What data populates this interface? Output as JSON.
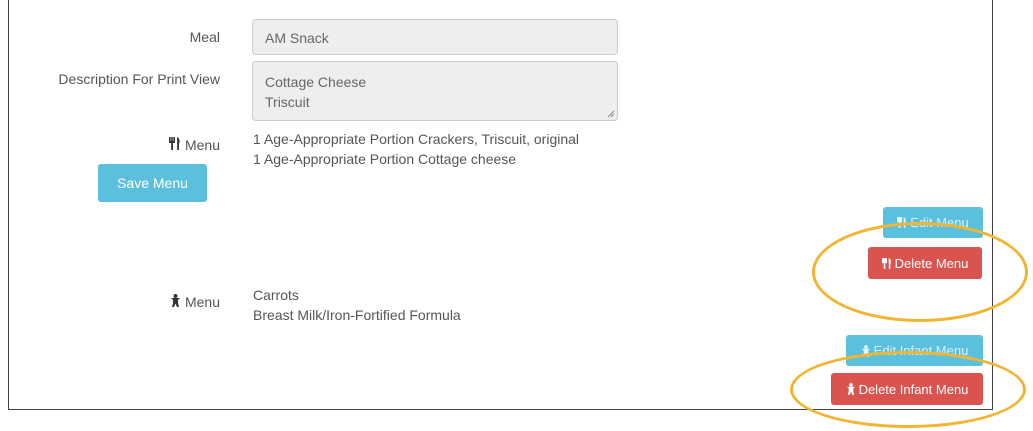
{
  "form": {
    "meal_label": "Meal",
    "meal_value": "AM Snack",
    "description_label": "Description For Print View",
    "description_lines": [
      "Cottage Cheese",
      "Triscuit"
    ],
    "menu_label": "Menu",
    "menu_items": [
      "1 Age-Appropriate Portion Crackers, Triscuit, original",
      "1 Age-Appropriate Portion Cottage cheese"
    ],
    "save_menu_label": "Save Menu",
    "edit_menu_label": "Edit Menu",
    "delete_menu_label": "Delete Menu",
    "infant_menu_label": "Menu",
    "infant_menu_items": [
      "Carrots",
      "Breast Milk/Iron-Fortified Formula"
    ],
    "edit_infant_menu_label": "Edit Infant Menu",
    "delete_infant_menu_label": "Delete Infant Menu"
  },
  "icons": {
    "menu_icon": "fork-knife-icon",
    "infant_icon": "baby-icon"
  },
  "colors": {
    "info_button": "#5bc0de",
    "danger_button": "#d9534f",
    "highlight": "#f0b532"
  }
}
